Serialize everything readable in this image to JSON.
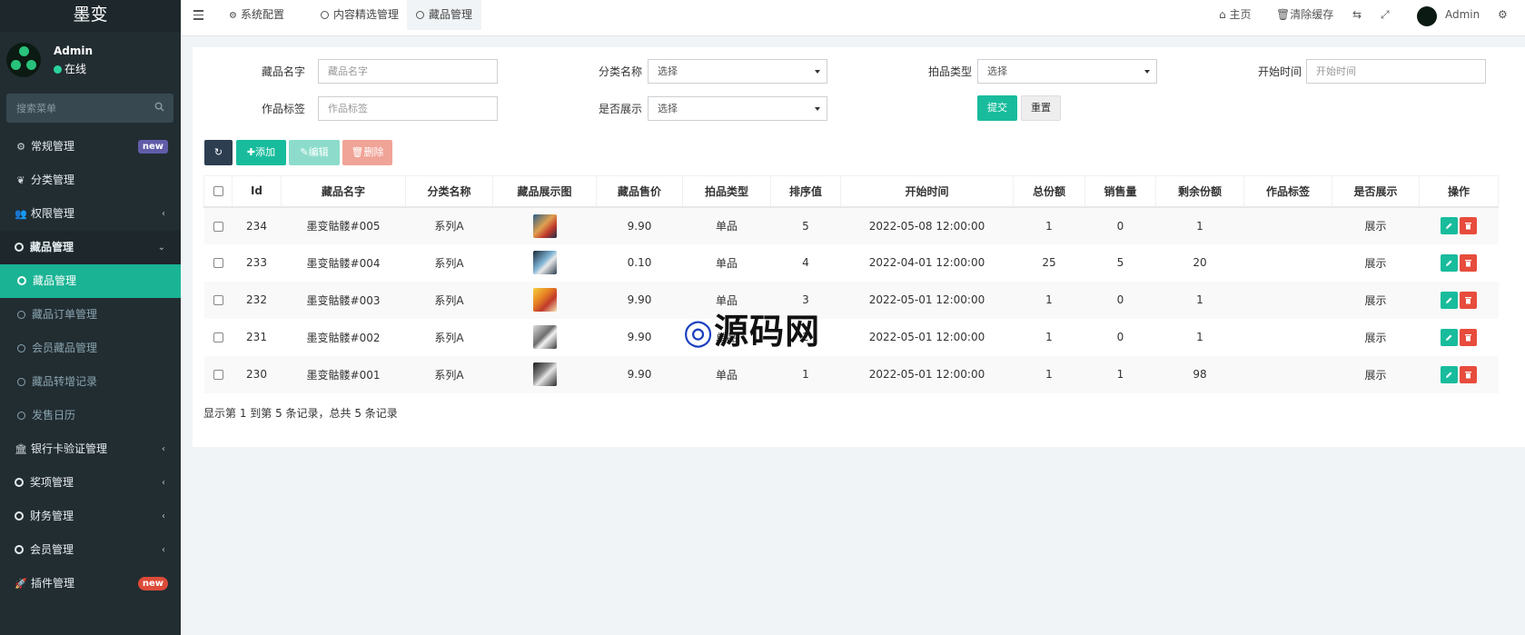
{
  "app": {
    "name": "墨变"
  },
  "user": {
    "name": "Admin",
    "status": "在线"
  },
  "search": {
    "placeholder": "搜索菜单"
  },
  "sidebar": {
    "items": [
      {
        "label": "常规管理",
        "icon": "cogs-icon",
        "badge": "new"
      },
      {
        "label": "分类管理",
        "icon": "leaf-icon"
      },
      {
        "label": "权限管理",
        "icon": "users-icon"
      },
      {
        "label": "藏品管理",
        "icon": "circle-icon"
      },
      {
        "label": "藏品管理",
        "icon": "circle-icon"
      },
      {
        "label": "藏品订单管理",
        "icon": "circle-icon"
      },
      {
        "label": "会员藏品管理",
        "icon": "circle-icon"
      },
      {
        "label": "藏品转增记录",
        "icon": "circle-icon"
      },
      {
        "label": "发售日历",
        "icon": "circle-icon"
      },
      {
        "label": "银行卡验证管理",
        "icon": "bank-icon"
      },
      {
        "label": "奖项管理",
        "icon": "circle-icon"
      },
      {
        "label": "财务管理",
        "icon": "circle-icon"
      },
      {
        "label": "会员管理",
        "icon": "circle-icon"
      },
      {
        "label": "插件管理",
        "icon": "rocket-icon",
        "badge": "new"
      }
    ]
  },
  "topbar": {
    "tabs": [
      {
        "label": "系统配置",
        "icon": "gear-icon"
      },
      {
        "label": "内容精选管理",
        "icon": "circle-icon"
      },
      {
        "label": "藏品管理",
        "icon": "circle-icon"
      }
    ],
    "home": "主页",
    "clear_cache": "清除缓存",
    "user": "Admin"
  },
  "filters": {
    "name_label": "藏品名字",
    "name_placeholder": "藏品名字",
    "category_label": "分类名称",
    "category_value": "选择",
    "auction_label": "拍品类型",
    "auction_value": "选择",
    "start_label": "开始时间",
    "start_placeholder": "开始时间",
    "tag_label": "作品标签",
    "tag_placeholder": "作品标签",
    "show_label": "是否展示",
    "show_value": "选择",
    "submit": "提交",
    "reset": "重置"
  },
  "toolbar": {
    "add": "添加",
    "edit": "编辑",
    "delete": "删除"
  },
  "table": {
    "headers": [
      "Id",
      "藏品名字",
      "分类名称",
      "藏品展示图",
      "藏品售价",
      "拍品类型",
      "排序值",
      "开始时间",
      "总份额",
      "销售量",
      "剩余份额",
      "作品标签",
      "是否展示",
      "操作"
    ],
    "rows": [
      {
        "id": "234",
        "name": "墨变骷髅#005",
        "category": "系列A",
        "price": "9.90",
        "type": "单品",
        "sort": "5",
        "start": "2022-05-08 12:00:00",
        "total": "1",
        "sold": "0",
        "remain": "1",
        "tag": "",
        "show": "展示"
      },
      {
        "id": "233",
        "name": "墨变骷髅#004",
        "category": "系列A",
        "price": "0.10",
        "type": "单品",
        "sort": "4",
        "start": "2022-04-01 12:00:00",
        "total": "25",
        "sold": "5",
        "remain": "20",
        "tag": "",
        "show": "展示"
      },
      {
        "id": "232",
        "name": "墨变骷髅#003",
        "category": "系列A",
        "price": "9.90",
        "type": "单品",
        "sort": "3",
        "start": "2022-05-01 12:00:00",
        "total": "1",
        "sold": "0",
        "remain": "1",
        "tag": "",
        "show": "展示"
      },
      {
        "id": "231",
        "name": "墨变骷髅#002",
        "category": "系列A",
        "price": "9.90",
        "type": "单品",
        "sort": "2",
        "start": "2022-05-01 12:00:00",
        "total": "1",
        "sold": "0",
        "remain": "1",
        "tag": "",
        "show": "展示"
      },
      {
        "id": "230",
        "name": "墨变骷髅#001",
        "category": "系列A",
        "price": "9.90",
        "type": "单品",
        "sort": "1",
        "start": "2022-05-01 12:00:00",
        "total": "1",
        "sold": "1",
        "remain": "98",
        "tag": "",
        "show": "展示"
      }
    ],
    "summary": "显示第 1 到第 5 条记录，总共 5 条记录"
  },
  "watermark": {
    "text": "源码网"
  },
  "colors": {
    "sidebar": "#222d32",
    "accent": "#18bc9c",
    "danger": "#e74c3c"
  }
}
